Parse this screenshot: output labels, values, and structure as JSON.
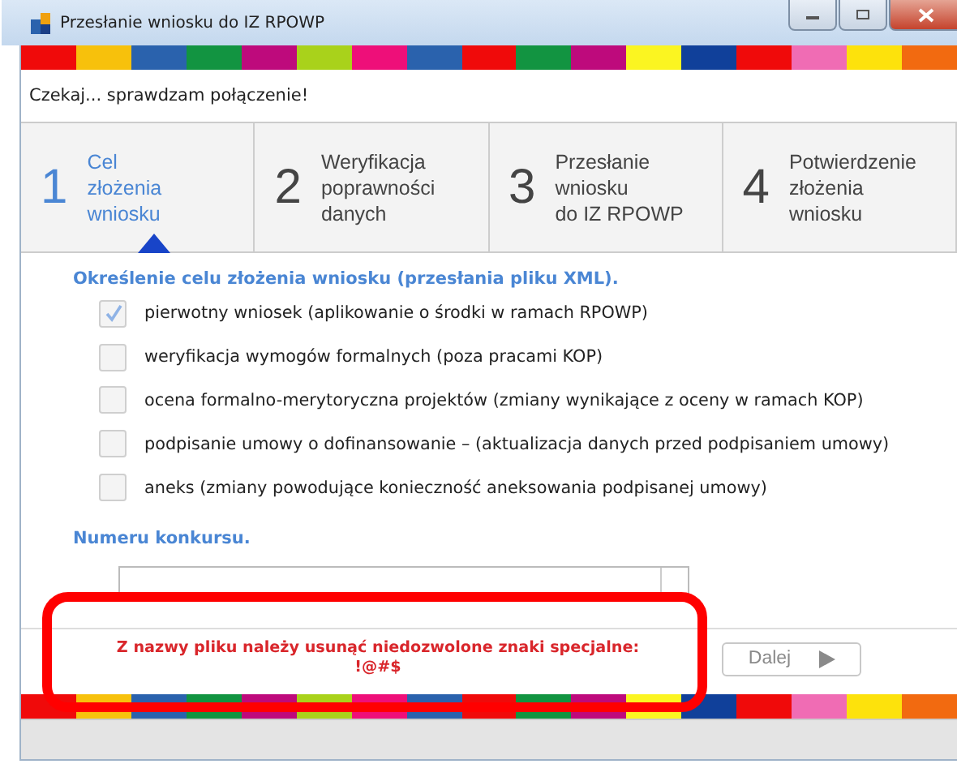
{
  "window": {
    "title": "Przesłanie wniosku do IZ RPOWP"
  },
  "status": "Czekaj... sprawdzam połączenie!",
  "steps": [
    {
      "number": "1",
      "label": "Cel\nzłożenia\nwniosku",
      "selected": true
    },
    {
      "number": "2",
      "label": "Weryfikacja\npoprawności\ndanych",
      "selected": false
    },
    {
      "number": "3",
      "label": "Przesłanie\nwniosku\ndo IZ RPOWP",
      "selected": false
    },
    {
      "number": "4",
      "label": "Potwierdzenie\nzłożenia\nwniosku",
      "selected": false
    }
  ],
  "purpose_heading": "Określenie celu złożenia wniosku (przesłania pliku XML).",
  "options": [
    {
      "label": "pierwotny wniosek (aplikowanie o środki w ramach RPOWP)",
      "checked": true
    },
    {
      "label": "weryfikacja wymogów formalnych (poza pracami KOP)",
      "checked": false
    },
    {
      "label": "ocena formalno-merytoryczna projektów (zmiany wynikające z oceny w ramach KOP)",
      "checked": false
    },
    {
      "label": "podpisanie umowy o dofinansowanie – (aktualizacja danych przed podpisaniem umowy)",
      "checked": false
    },
    {
      "label": "aneks (zmiany powodujące konieczność aneksowania podpisanej umowy)",
      "checked": false
    }
  ],
  "contest_heading": "Numeru konkursu.",
  "error": "Z nazwy pliku należy usunąć niedozwolone znaki specjalne:\n!@#$",
  "next_button": {
    "label": "Dalej",
    "disabled": true
  }
}
